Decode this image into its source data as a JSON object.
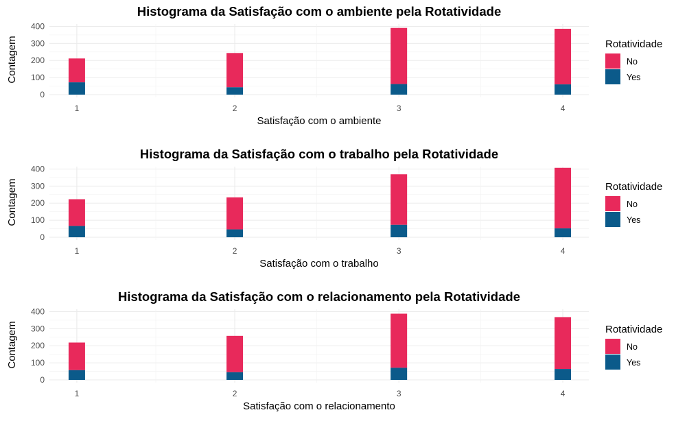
{
  "colors": {
    "no": "#E8295B",
    "yes": "#0B5A8A",
    "grid": "#EBEBEB",
    "axis_text": "#4D4D4D"
  },
  "chart_data": [
    {
      "type": "bar",
      "stacked": true,
      "title": "Histograma da Satisfação com o ambiente pela Rotatividade",
      "xlabel": "Satisfação com o ambiente",
      "ylabel": "Contagem",
      "ylim": [
        0,
        410
      ],
      "yticks": [
        0,
        100,
        200,
        300,
        400
      ],
      "categories": [
        "1",
        "2",
        "3",
        "4"
      ],
      "legend": {
        "title": "Rotatividade",
        "position": "right"
      },
      "series": [
        {
          "name": "Yes",
          "values": [
            72,
            43,
            62,
            60
          ]
        },
        {
          "name": "No",
          "values": [
            212,
            244,
            391,
            386
          ]
        }
      ],
      "grid": true
    },
    {
      "type": "bar",
      "stacked": true,
      "title": "Histograma da Satisfação com o trabalho pela Rotatividade",
      "xlabel": "Satisfação com o trabalho",
      "ylabel": "Contagem",
      "ylim": [
        0,
        410
      ],
      "yticks": [
        0,
        100,
        200,
        300,
        400
      ],
      "categories": [
        "1",
        "2",
        "3",
        "4"
      ],
      "legend": {
        "title": "Rotatividade",
        "position": "right"
      },
      "series": [
        {
          "name": "Yes",
          "values": [
            66,
            46,
            73,
            52
          ]
        },
        {
          "name": "No",
          "values": [
            223,
            234,
            369,
            407
          ]
        }
      ],
      "grid": true
    },
    {
      "type": "bar",
      "stacked": true,
      "title": "Histograma da Satisfação com o relacionamento pela Rotatividade",
      "xlabel": "Satisfação com o relacionamento",
      "ylabel": "Contagem",
      "ylim": [
        0,
        410
      ],
      "yticks": [
        0,
        100,
        200,
        300,
        400
      ],
      "categories": [
        "1",
        "2",
        "3",
        "4"
      ],
      "legend": {
        "title": "Rotatividade",
        "position": "right"
      },
      "series": [
        {
          "name": "Yes",
          "values": [
            57,
            45,
            71,
            64
          ]
        },
        {
          "name": "No",
          "values": [
            219,
            258,
            388,
            368
          ]
        }
      ],
      "grid": true
    }
  ]
}
